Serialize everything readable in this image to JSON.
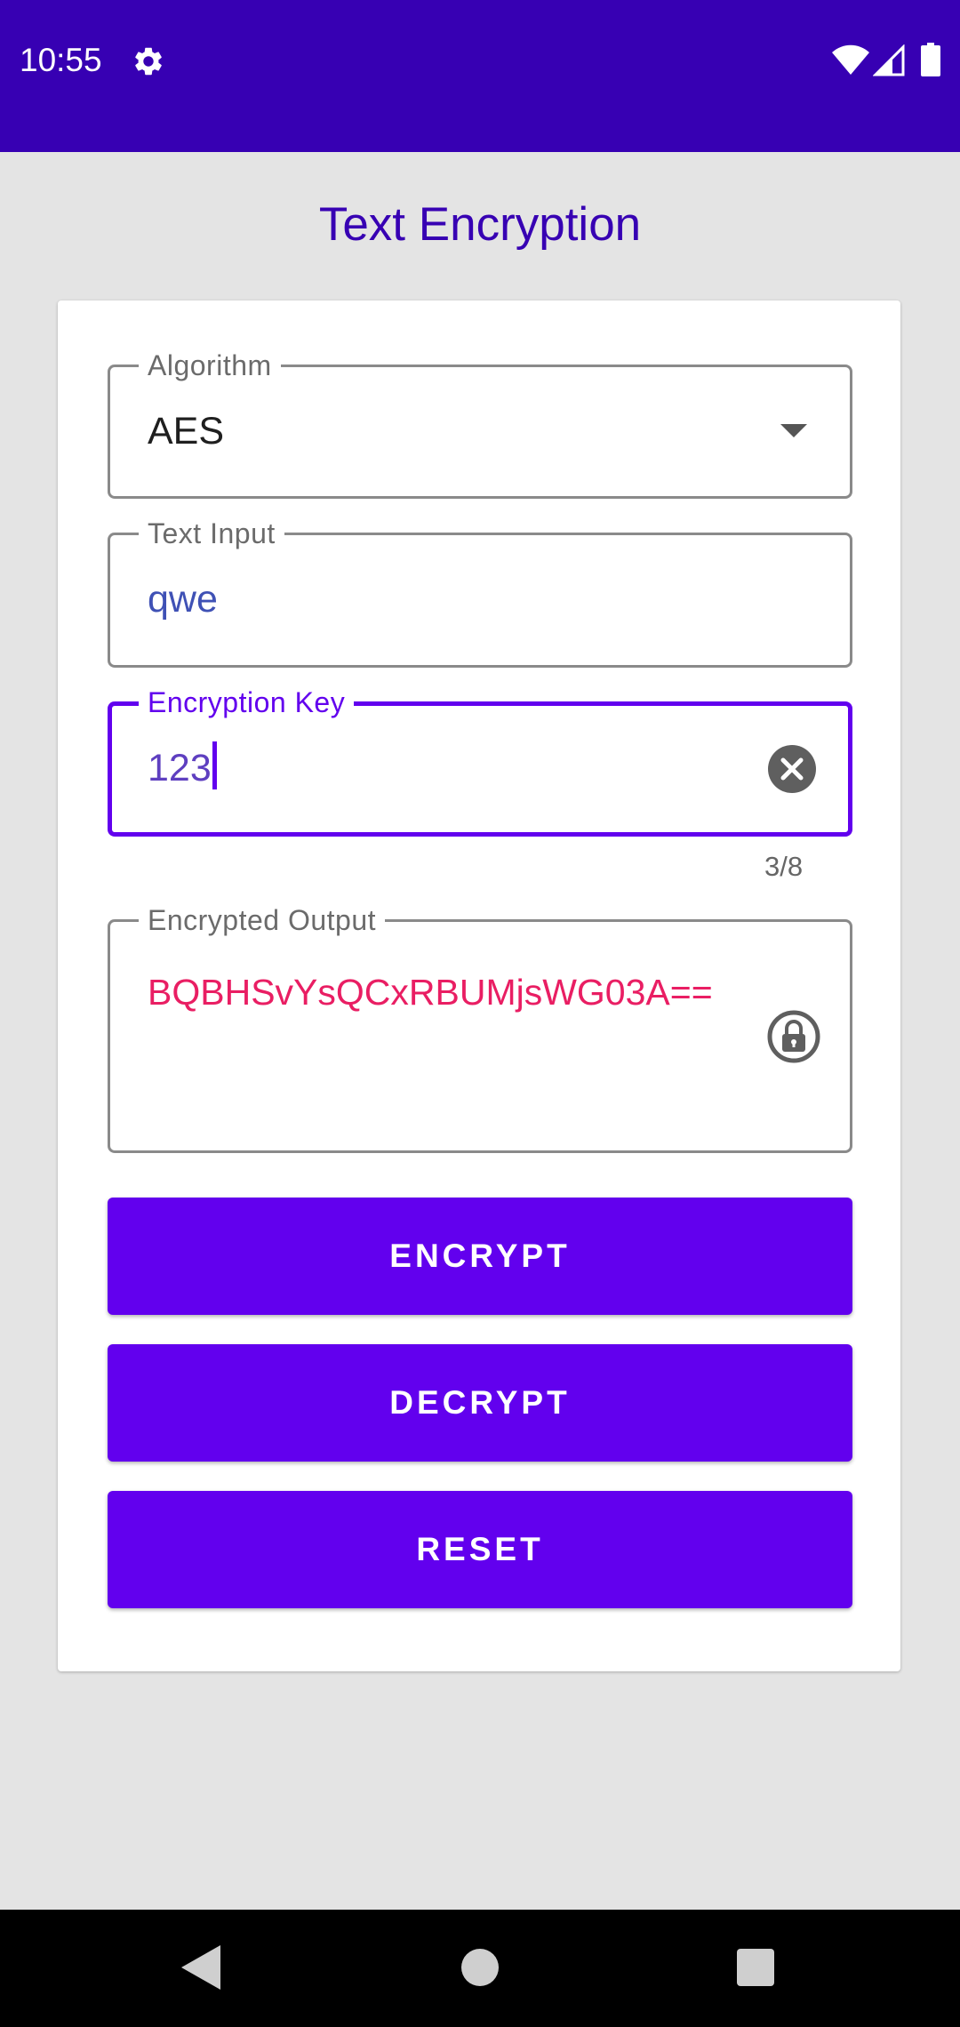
{
  "status_bar": {
    "time": "10:55",
    "icons": [
      "gear-icon",
      "wifi-icon",
      "signal-icon",
      "battery-icon"
    ],
    "background": "#3700b3"
  },
  "page": {
    "title": "Text Encryption"
  },
  "form": {
    "algorithm": {
      "label": "Algorithm",
      "value": "AES"
    },
    "text_input": {
      "label": "Text Input",
      "value": "qwe"
    },
    "encryption_key": {
      "label": "Encryption Key",
      "value": "123",
      "counter": "3/8",
      "trailing_icon": "clear-icon"
    },
    "encrypted_output": {
      "label": "Encrypted Output",
      "value": "BQBHSvYsQCxRBUMjsWG03A==",
      "trailing_icon": "lock-icon"
    }
  },
  "buttons": {
    "encrypt_label": "ENCRYPT",
    "decrypt_label": "DECRYPT",
    "reset_label": "RESET"
  },
  "nav_bar": {
    "icons": [
      "back-icon",
      "home-icon",
      "recents-icon"
    ]
  },
  "colors": {
    "primary": "#6200ee",
    "primary_dark": "#3700b3",
    "output_text": "#e91e63",
    "input_text": "#3f51b5"
  }
}
